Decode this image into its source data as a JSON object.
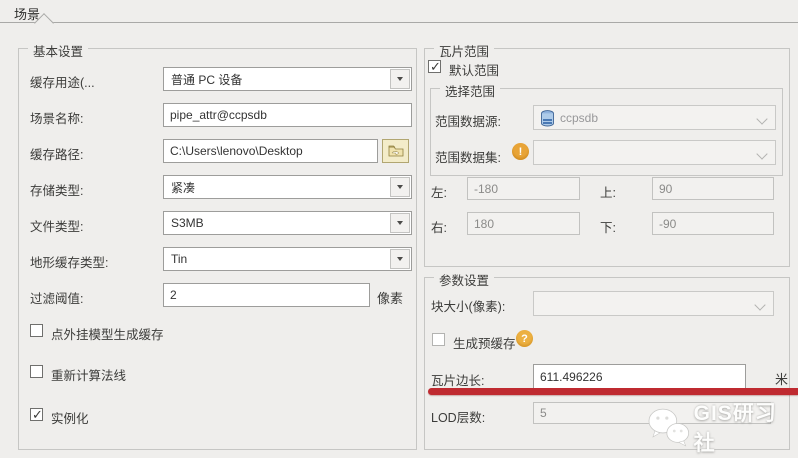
{
  "tab": {
    "label": "场景"
  },
  "basic": {
    "title": "基本设置",
    "rows": {
      "cache_usage": {
        "label": "缓存用途(...",
        "value": "普通 PC 设备"
      },
      "scene_name": {
        "label": "场景名称:",
        "value": "pipe_attr@ccpsdb"
      },
      "cache_path": {
        "label": "缓存路径:",
        "value": "C:\\Users\\lenovo\\Desktop"
      },
      "storage_type": {
        "label": "存储类型:",
        "value": "紧凑"
      },
      "file_type": {
        "label": "文件类型:",
        "value": "S3MB"
      },
      "terrain_cache_type": {
        "label": "地形缓存类型:",
        "value": "Tin"
      },
      "filter_threshold": {
        "label": "过滤阈值:",
        "value": "2",
        "unit": "像素"
      }
    },
    "checkboxes": [
      {
        "label": "点外挂模型生成缓存",
        "checked": false
      },
      {
        "label": "重新计算法线",
        "checked": false
      },
      {
        "label": "实例化",
        "checked": true
      }
    ]
  },
  "tile_range": {
    "title": "瓦片范围",
    "default_range": {
      "label": "默认范围",
      "checked": true
    },
    "select_range": {
      "title": "选择范围",
      "datasource": {
        "label": "范围数据源:",
        "value": "ccpsdb"
      },
      "dataset": {
        "label": "范围数据集:",
        "value": "",
        "warning": "!"
      }
    },
    "bounds": {
      "left": {
        "label": "左:",
        "value": "-180"
      },
      "top": {
        "label": "上:",
        "value": "90"
      },
      "right": {
        "label": "右:",
        "value": "180"
      },
      "bottom": {
        "label": "下:",
        "value": "-90"
      }
    }
  },
  "params": {
    "title": "参数设置",
    "block_size": {
      "label": "块大小(像素):",
      "value": ""
    },
    "pre_cache": {
      "label": "生成预缓存",
      "checked": false,
      "help": "?"
    },
    "tile_side": {
      "label": "瓦片边长:",
      "value": "611.496226",
      "unit": "米"
    },
    "lod_layers": {
      "label": "LOD层数:",
      "value": "5"
    }
  },
  "annotation": {
    "color": "#bf2a30"
  },
  "watermark": {
    "text": "GIS研习社"
  }
}
